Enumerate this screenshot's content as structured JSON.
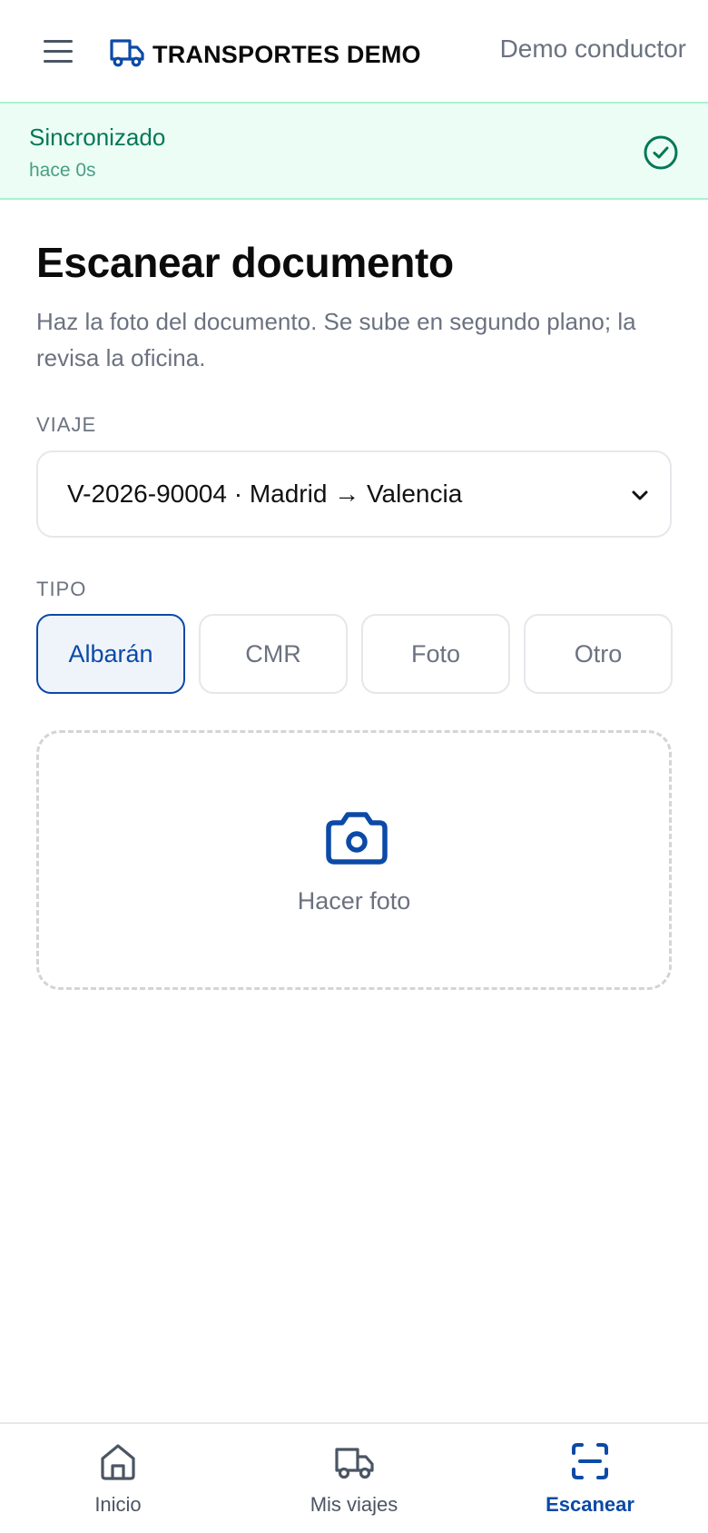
{
  "header": {
    "brand_name": "TRANSPORTES DEMO",
    "user_name": "Demo conductor",
    "brand_color": "#0b4aa6"
  },
  "sync": {
    "status": "Sincronizado",
    "detail": "hace 0s",
    "color": "#047857"
  },
  "main": {
    "title": "Escanear documento",
    "subtitle": "Haz la foto del documento. Se sube en segundo plano; la revisa la oficina.",
    "trip_label": "VIAJE",
    "trip_selected": "V-2026-90004 · Madrid → Valencia",
    "type_label": "TIPO",
    "types": [
      {
        "label": "Albarán",
        "active": true
      },
      {
        "label": "CMR",
        "active": false
      },
      {
        "label": "Foto",
        "active": false
      },
      {
        "label": "Otro",
        "active": false
      }
    ],
    "photo_label": "Hacer foto"
  },
  "bottom_nav": {
    "items": [
      {
        "label": "Inicio",
        "icon": "home-icon",
        "active": false
      },
      {
        "label": "Mis viajes",
        "icon": "truck-icon",
        "active": false
      },
      {
        "label": "Escanear",
        "icon": "scan-icon",
        "active": true
      }
    ]
  }
}
